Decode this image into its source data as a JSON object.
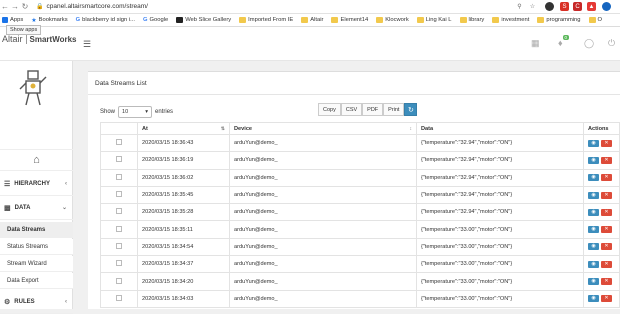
{
  "browser": {
    "url": "cpanel.altairsmartcore.com/stream/",
    "bookmarks": [
      {
        "label": "Apps",
        "icon": "apps-grid-icon"
      },
      {
        "label": "Bookmarks",
        "icon": "star-icon"
      },
      {
        "label": "blackberry id sign i...",
        "icon": "google-icon"
      },
      {
        "label": "Google",
        "icon": "google-icon"
      },
      {
        "label": "Web Slice Gallery",
        "icon": "web-slice-icon"
      },
      {
        "label": "Imported From IE",
        "icon": "folder-icon"
      },
      {
        "label": "Altair",
        "icon": "folder-icon"
      },
      {
        "label": "Element14",
        "icon": "folder-icon"
      },
      {
        "label": "Klocwork",
        "icon": "folder-icon"
      },
      {
        "label": "Ling Kai L",
        "icon": "folder-icon"
      },
      {
        "label": "library",
        "icon": "folder-icon"
      },
      {
        "label": "investment",
        "icon": "folder-icon"
      },
      {
        "label": "programming",
        "icon": "folder-icon"
      },
      {
        "label": "O",
        "icon": "folder-icon"
      }
    ],
    "tooltip": "Show apps"
  },
  "header": {
    "logo_brand": "Altair",
    "logo_product": "SmartWorks",
    "notification_count": "0"
  },
  "sidebar": {
    "sections": [
      {
        "label": "HIERARCHY"
      },
      {
        "label": "DATA"
      },
      {
        "label": "RULES"
      }
    ],
    "data_items": [
      "Data Streams",
      "Status Streams",
      "Stream Wizard",
      "Data Export"
    ]
  },
  "content": {
    "title": "Data Streams List",
    "show_label": "Show",
    "entries_value": "10",
    "entries_label": "entries",
    "buttons": [
      "Copy",
      "CSV",
      "PDF",
      "Print"
    ],
    "columns": [
      "At",
      "Device",
      "Data",
      "Actions"
    ],
    "rows": [
      {
        "at": "2020/03/15 18:36:43",
        "device": "arduYun@demo_",
        "data": "{\"temperature\":\"32.94\",\"motor\":\"ON\"}"
      },
      {
        "at": "2020/03/15 18:36:19",
        "device": "arduYun@demo_",
        "data": "{\"temperature\":\"32.94\",\"motor\":\"ON\"}"
      },
      {
        "at": "2020/03/15 18:36:02",
        "device": "arduYun@demo_",
        "data": "{\"temperature\":\"32.94\",\"motor\":\"ON\"}"
      },
      {
        "at": "2020/03/15 18:35:45",
        "device": "arduYun@demo_",
        "data": "{\"temperature\":\"32.94\",\"motor\":\"ON\"}"
      },
      {
        "at": "2020/03/15 18:35:28",
        "device": "arduYun@demo_",
        "data": "{\"temperature\":\"32.94\",\"motor\":\"ON\"}"
      },
      {
        "at": "2020/03/15 18:35:11",
        "device": "arduYun@demo_",
        "data": "{\"temperature\":\"33.00\",\"motor\":\"ON\"}"
      },
      {
        "at": "2020/03/15 18:34:54",
        "device": "arduYun@demo_",
        "data": "{\"temperature\":\"33.00\",\"motor\":\"ON\"}"
      },
      {
        "at": "2020/03/15 18:34:37",
        "device": "arduYun@demo_",
        "data": "{\"temperature\":\"33.00\",\"motor\":\"ON\"}"
      },
      {
        "at": "2020/03/15 18:34:20",
        "device": "arduYun@demo_",
        "data": "{\"temperature\":\"33.00\",\"motor\":\"ON\"}"
      },
      {
        "at": "2020/03/15 18:34:03",
        "device": "arduYun@demo_",
        "data": "{\"temperature\":\"33.00\",\"motor\":\"ON\"}"
      }
    ]
  },
  "colors": {
    "accent": "#3c8dbc",
    "delete": "#dd4b39",
    "badge": "#5cb85c"
  }
}
